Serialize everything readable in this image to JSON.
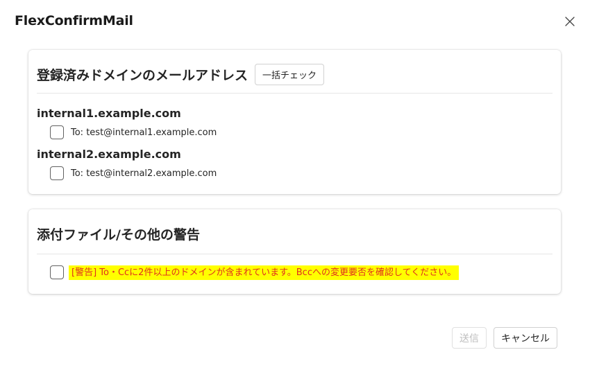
{
  "dialog": {
    "title": "FlexConfirmMail",
    "close_icon": "close-icon"
  },
  "registered": {
    "heading": "登録済みドメインのメールアドレス",
    "bulk_check_label": "一括チェック",
    "domains": [
      {
        "name": "internal1.example.com",
        "address": "To: test@internal1.example.com"
      },
      {
        "name": "internal2.example.com",
        "address": "To: test@internal2.example.com"
      }
    ]
  },
  "attachments": {
    "heading": "添付ファイル/その他の警告",
    "warning": "[警告] To・Ccに2件以上のドメインが含まれています。Bccへの変更要否を確認してください。"
  },
  "footer": {
    "send_label": "送信",
    "cancel_label": "キャンセル"
  },
  "colors": {
    "warning_text": "#e0301e",
    "warning_highlight": "#ffff00"
  }
}
